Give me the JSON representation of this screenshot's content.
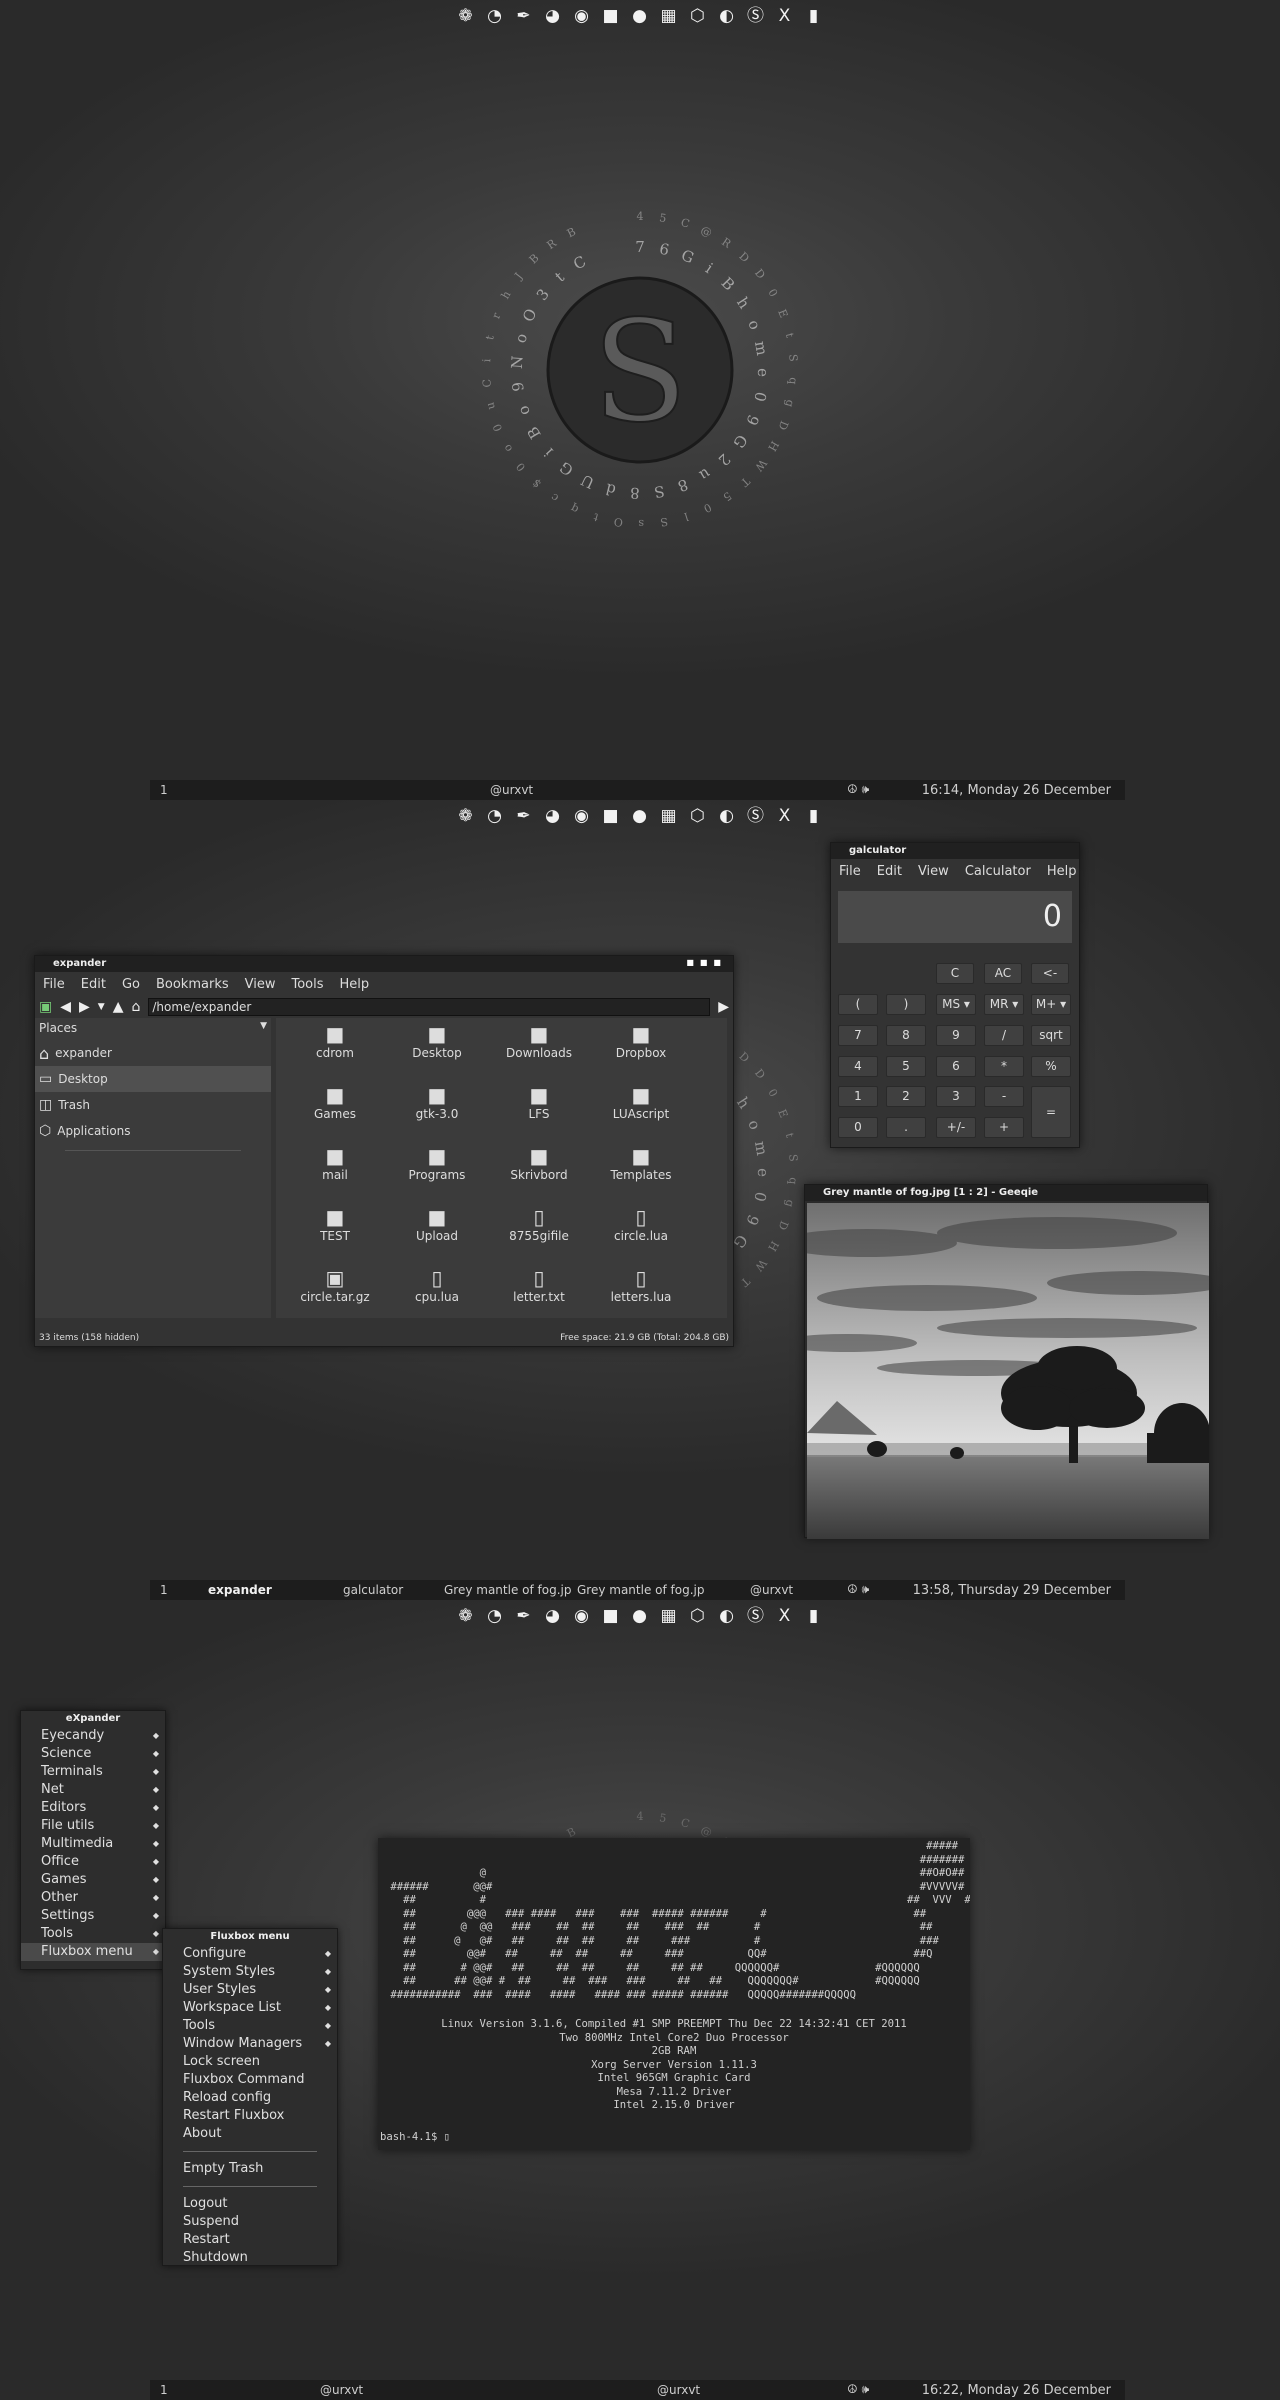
{
  "dock_icons": [
    "fluxbox-icon",
    "firefox-icon",
    "pen-icon",
    "burn-icon",
    "chrome-icon",
    "folder-icon",
    "chat-icon",
    "calculator-icon",
    "box-icon",
    "steam-icon",
    "skype-icon",
    "x-icon",
    "document-icon"
  ],
  "dock_glyphs": [
    "❁",
    "◔",
    "✒",
    "◕",
    "◉",
    "■",
    "●",
    "▦",
    "⬡",
    "◐",
    "Ⓢ",
    "X",
    "▮"
  ],
  "logo": {
    "letter": "S",
    "ring_text": "45C@RDD0EtSqgDHWT50lSsOtqc$0o0uCitrhJBRB",
    "inner_ring": "76GiBhome09G2u8S8dUGiBo9NoO3tC",
    "bottom": "0OqIp"
  },
  "screen1": {
    "taskbar": {
      "workspace": "1",
      "items": [
        "@urxvt"
      ],
      "clock": "16:14, Monday 26 December"
    }
  },
  "screen2": {
    "file_manager": {
      "title": "expander",
      "menu": [
        "File",
        "Edit",
        "Go",
        "Bookmarks",
        "View",
        "Tools",
        "Help"
      ],
      "path": "/home/expander",
      "places_header": "Places",
      "places": [
        "expander",
        "Desktop",
        "Trash",
        "Applications"
      ],
      "files": [
        {
          "name": "cdrom",
          "type": "folder"
        },
        {
          "name": "Desktop",
          "type": "folder"
        },
        {
          "name": "Downloads",
          "type": "folder"
        },
        {
          "name": "Dropbox",
          "type": "folder"
        },
        {
          "name": "Games",
          "type": "folder"
        },
        {
          "name": "gtk-3.0",
          "type": "folder"
        },
        {
          "name": "LFS",
          "type": "folder"
        },
        {
          "name": "LUAscript",
          "type": "folder"
        },
        {
          "name": "mail",
          "type": "folder"
        },
        {
          "name": "Programs",
          "type": "folder"
        },
        {
          "name": "Skrivbord",
          "type": "folder"
        },
        {
          "name": "Templates",
          "type": "folder"
        },
        {
          "name": "TEST",
          "type": "folder"
        },
        {
          "name": "Upload",
          "type": "folder"
        },
        {
          "name": "8755gifile",
          "type": "file"
        },
        {
          "name": "circle.lua",
          "type": "file"
        },
        {
          "name": "circle.tar.gz",
          "type": "archive"
        },
        {
          "name": "cpu.lua",
          "type": "file"
        },
        {
          "name": "letter.txt",
          "type": "file"
        },
        {
          "name": "letters.lua",
          "type": "file"
        }
      ],
      "status_left": "33 items (158 hidden)",
      "status_right": "Free space: 21.9 GB (Total: 204.8 GB)"
    },
    "calculator": {
      "title": "galculator",
      "menu": [
        "File",
        "Edit",
        "View",
        "Calculator",
        "Help"
      ],
      "display": "0",
      "buttons": [
        "C",
        "AC",
        "<-",
        "(",
        ")",
        "MS ▾",
        "MR ▾",
        "M+ ▾",
        "7",
        "8",
        "9",
        "/",
        "sqrt",
        "4",
        "5",
        "6",
        "*",
        "%",
        "1",
        "2",
        "3",
        "-",
        "=",
        "0",
        ".",
        "+/-",
        "+"
      ]
    },
    "image_viewer": {
      "title": "Grey mantle of fog.jpg [1 : 2] - Geeqie"
    },
    "taskbar": {
      "workspace": "1",
      "items": [
        "expander",
        "galculator",
        "Grey mantle of fog.jp",
        "Grey mantle of fog.jp",
        "@urxvt"
      ],
      "clock": "13:58, Thursday 29 December"
    }
  },
  "screen3": {
    "root_menu": {
      "title": "eXpander",
      "items": [
        "Eyecandy",
        "Science",
        "Terminals",
        "Net",
        "Editors",
        "File utils",
        "Multimedia",
        "Office",
        "Games",
        "Other",
        "Settings",
        "Tools",
        "Fluxbox menu"
      ]
    },
    "fluxbox_menu": {
      "title": "Fluxbox menu",
      "items": [
        "Configure",
        "System Styles",
        "User Styles",
        "Workspace List",
        "Tools",
        "Window Managers",
        "Lock screen",
        "Fluxbox Command",
        "Reload config",
        "Restart Fluxbox",
        "About"
      ],
      "empty_trash": "Empty Trash",
      "session": [
        "Logout",
        "Suspend",
        "Restart",
        "Shutdown"
      ]
    },
    "terminal": {
      "ascii": "                                                                                     #####\n                                                                                    #######\n               @                                                                    ##O#O##\n ######       @@#                                                                   #VVVVV#\n   ##          #                                                                  ##  VVV  ##\n   ##        @@@   ### ####   ###    ###  ##### ######     #                       ##\n   ##       @  @@   ###    ##  ##     ##    ###  ##       #                         ##\n   ##      @   @#   ##     ##  ##     ##     ###          #                         ###\n   ##        @@#   ##     ##  ##     ##     ###          QQ#                       ##Q\n   ##       # @@#   ##     ##  ##     ##     ## ##     QQQQQQ#               #QQQQQQ\n   ##      ## @@# #  ##     ##  ###   ###     ##   ##    QQQQQQQ#            #QQQQQQ\n ###########  ###  ####   ####   #### ### ##### ######   QQQQQ#######QQQQQ",
      "info": [
        "Linux Version 3.1.6, Compiled #1 SMP PREEMPT Thu Dec 22 14:32:41 CET 2011",
        "Two 800MHz Intel Core2 Duo Processor",
        "2GB RAM",
        "Xorg Server Version 1.11.3",
        "Intel 965GM Graphic Card",
        "Mesa 7.11.2 Driver",
        "Intel 2.15.0 Driver"
      ],
      "prompt": "bash-4.1$"
    },
    "taskbar": {
      "workspace": "1",
      "items": [
        "@urxvt",
        "@urxvt"
      ],
      "clock": "16:22, Monday 26 December"
    }
  }
}
